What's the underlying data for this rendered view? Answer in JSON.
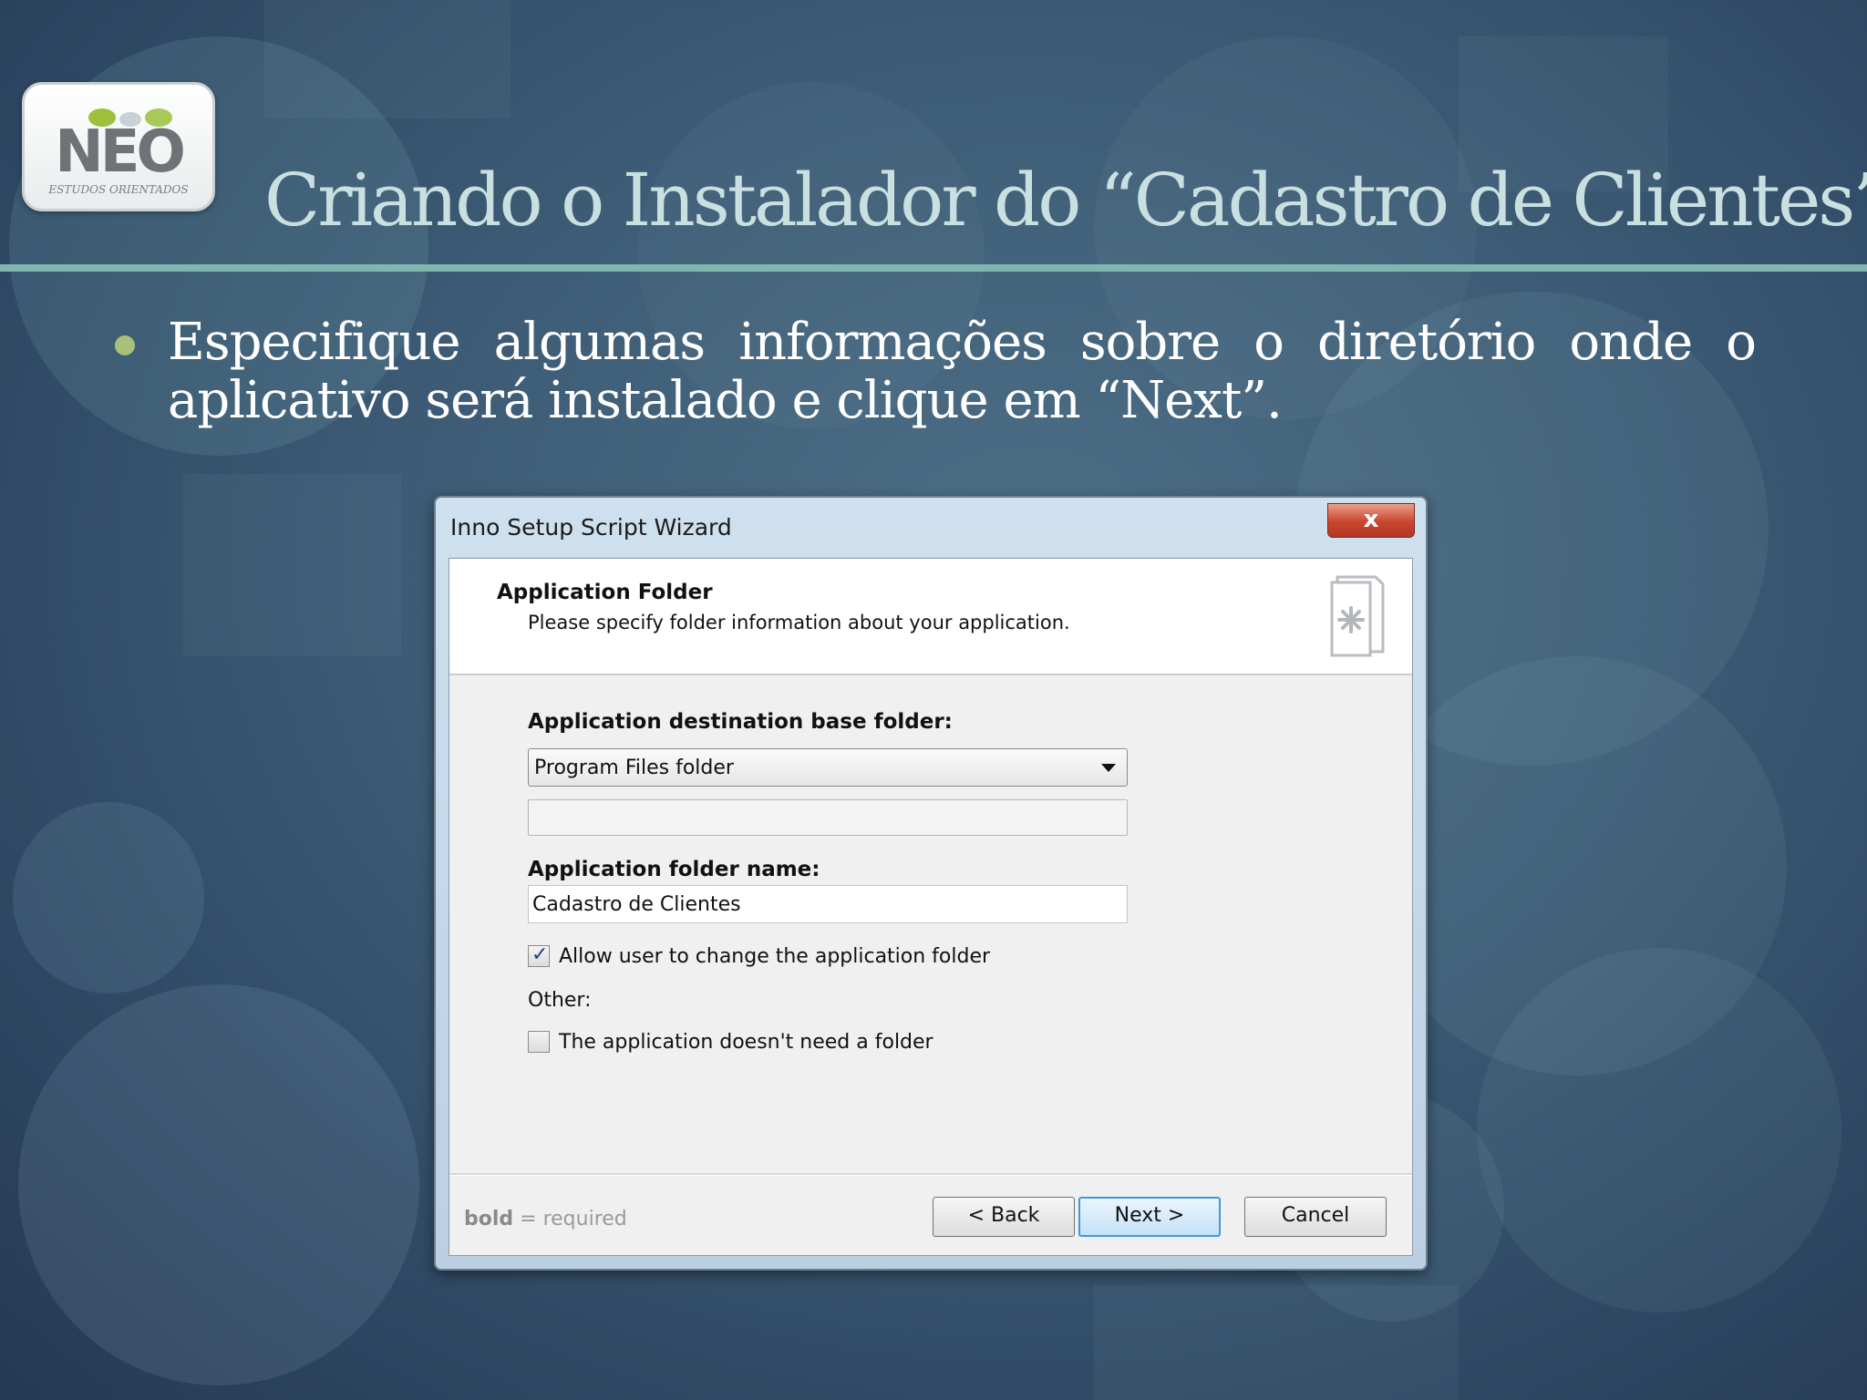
{
  "logo": {
    "brand": "NEO",
    "tagline": "ESTUDOS ORIENTADOS"
  },
  "slide": {
    "title": "Criando o Instalador do “Cadastro de Clientes”",
    "bullet": "Especifique algumas informações sobre o diretório onde o aplicativo será instalado e clique em “Next”."
  },
  "dialog": {
    "window_title": "Inno Setup Script Wizard",
    "close_glyph": "x",
    "header_title": "Application Folder",
    "header_subtitle": "Please specify folder information about your application.",
    "dest_label": "Application destination base folder:",
    "dest_select_value": "Program Files folder",
    "custom_path_value": "",
    "folder_name_label": "Application folder name:",
    "folder_name_value": "Cadastro de Clientes",
    "allow_change_label": "Allow user to change the application folder",
    "allow_change_checked": true,
    "other_label": "Other:",
    "no_folder_label": "The application doesn't need a folder",
    "no_folder_checked": false,
    "footer_bold": "bold",
    "footer_rest": " = required",
    "back_label": "< Back",
    "next_label": "Next >",
    "cancel_label": "Cancel"
  },
  "colors": {
    "slide_title": "#c9dfe0",
    "title_rule": "#7fb7b0",
    "bullet_dot": "#a9c07a",
    "close_button": "#c9452d",
    "next_focus": "#3c9ad8"
  }
}
